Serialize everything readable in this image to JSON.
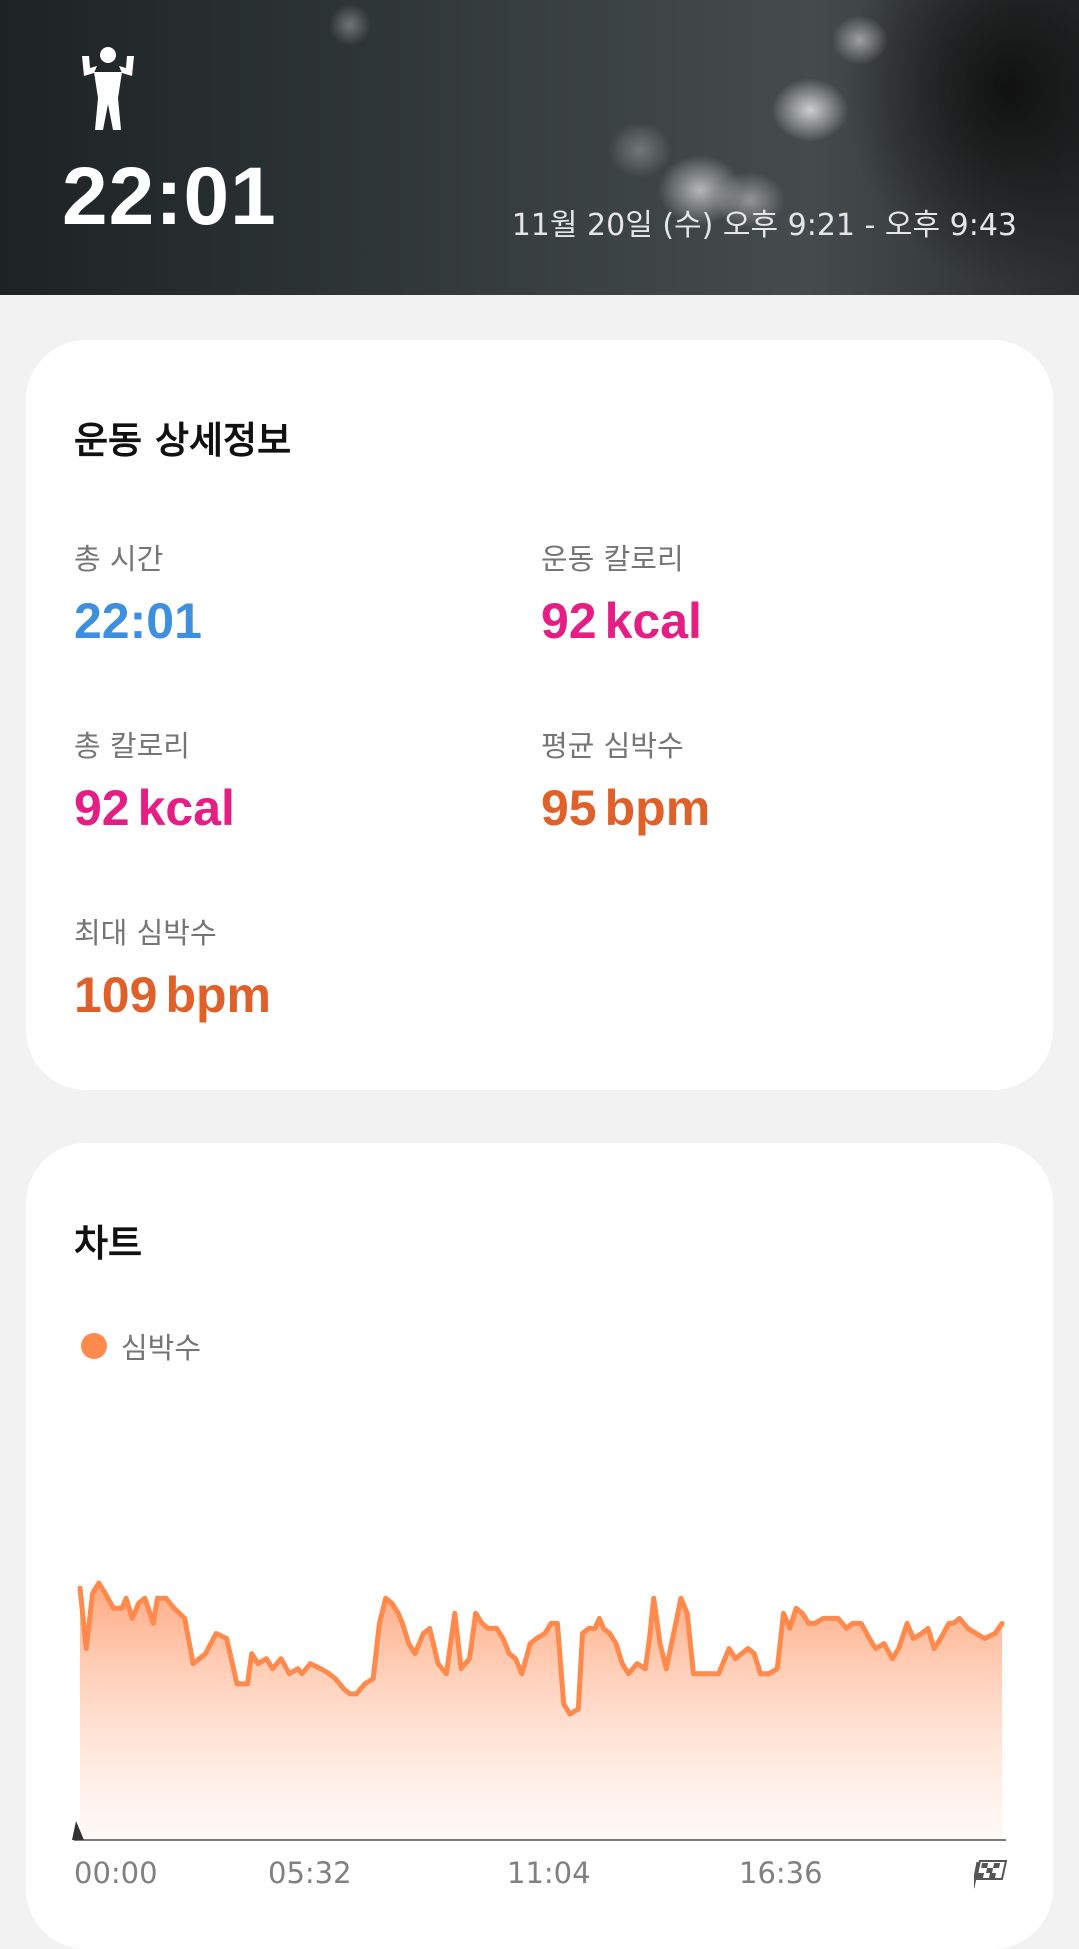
{
  "header": {
    "duration": "22:01",
    "date_range": "11월 20일 (수) 오후 9:21 - 오후 9:43",
    "workout_icon": "person-flexing-icon"
  },
  "details": {
    "title": "운동 상세정보",
    "stats": [
      {
        "label": "총 시간",
        "value": "22:01",
        "unit": "",
        "color": "#3d8fe0"
      },
      {
        "label": "운동 칼로리",
        "value": "92",
        "unit": "kcal",
        "color": "#e51e84"
      },
      {
        "label": "총 칼로리",
        "value": "92",
        "unit": "kcal",
        "color": "#e51e84"
      },
      {
        "label": "평균 심박수",
        "value": "95",
        "unit": "bpm",
        "color": "#e0602a"
      },
      {
        "label": "최대 심박수",
        "value": "109",
        "unit": "bpm",
        "color": "#e0602a"
      }
    ]
  },
  "chart_section": {
    "title": "차트",
    "legend_label": "심박수",
    "finish_icon": "checkered-flag-icon",
    "start_icon": "start-marker-icon"
  },
  "chart_data": {
    "type": "area",
    "series": [
      {
        "name": "심박수",
        "color": "#ff8a4c"
      }
    ],
    "x_tick_labels": [
      "00:00",
      "05:32",
      "11:04",
      "16:36"
    ],
    "x_unit": "mm:ss",
    "x_range": [
      "00:00",
      "22:01"
    ],
    "y_range_bpm": [
      58,
      112
    ],
    "grid": false,
    "legend_position": "top-left",
    "points": [
      [
        0.0,
        108
      ],
      [
        0.15,
        96
      ],
      [
        0.3,
        107
      ],
      [
        0.45,
        109
      ],
      [
        0.6,
        107
      ],
      [
        0.8,
        104
      ],
      [
        1.0,
        104
      ],
      [
        1.1,
        106
      ],
      [
        1.25,
        102
      ],
      [
        1.4,
        105
      ],
      [
        1.55,
        106
      ],
      [
        1.75,
        101
      ],
      [
        1.85,
        106
      ],
      [
        2.05,
        106
      ],
      [
        2.25,
        104
      ],
      [
        2.5,
        102
      ],
      [
        2.7,
        93
      ],
      [
        3.0,
        95
      ],
      [
        3.25,
        99
      ],
      [
        3.5,
        98
      ],
      [
        3.75,
        89
      ],
      [
        4.0,
        89
      ],
      [
        4.1,
        95
      ],
      [
        4.25,
        93
      ],
      [
        4.45,
        94
      ],
      [
        4.6,
        92
      ],
      [
        4.8,
        94
      ],
      [
        5.0,
        91
      ],
      [
        5.2,
        92
      ],
      [
        5.3,
        91
      ],
      [
        5.5,
        93
      ],
      [
        5.75,
        92
      ],
      [
        5.95,
        91
      ],
      [
        6.1,
        90
      ],
      [
        6.3,
        88
      ],
      [
        6.45,
        87
      ],
      [
        6.6,
        87
      ],
      [
        6.8,
        89
      ],
      [
        7.0,
        90
      ],
      [
        7.15,
        101
      ],
      [
        7.3,
        106
      ],
      [
        7.45,
        105
      ],
      [
        7.6,
        103
      ],
      [
        7.7,
        101
      ],
      [
        7.85,
        97
      ],
      [
        8.0,
        95
      ],
      [
        8.2,
        99
      ],
      [
        8.35,
        100
      ],
      [
        8.55,
        93
      ],
      [
        8.75,
        91
      ],
      [
        8.95,
        103
      ],
      [
        9.1,
        92
      ],
      [
        9.3,
        94
      ],
      [
        9.45,
        103
      ],
      [
        9.6,
        101
      ],
      [
        9.75,
        100
      ],
      [
        9.95,
        100
      ],
      [
        10.1,
        98
      ],
      [
        10.25,
        95
      ],
      [
        10.4,
        94
      ],
      [
        10.55,
        91
      ],
      [
        10.75,
        97
      ],
      [
        10.9,
        98
      ],
      [
        11.1,
        99
      ],
      [
        11.25,
        101
      ],
      [
        11.4,
        101
      ],
      [
        11.55,
        85
      ],
      [
        11.7,
        83
      ],
      [
        11.9,
        84
      ],
      [
        12.0,
        99
      ],
      [
        12.15,
        100
      ],
      [
        12.3,
        100
      ],
      [
        12.4,
        102
      ],
      [
        12.5,
        100
      ],
      [
        12.65,
        99
      ],
      [
        12.8,
        97
      ],
      [
        12.95,
        93
      ],
      [
        13.1,
        91
      ],
      [
        13.3,
        93
      ],
      [
        13.5,
        92
      ],
      [
        13.6,
        98
      ],
      [
        13.7,
        106
      ],
      [
        13.85,
        97
      ],
      [
        14.0,
        92
      ],
      [
        14.2,
        100
      ],
      [
        14.35,
        106
      ],
      [
        14.5,
        103
      ],
      [
        14.65,
        91
      ],
      [
        14.85,
        91
      ],
      [
        15.05,
        91
      ],
      [
        15.25,
        91
      ],
      [
        15.4,
        94
      ],
      [
        15.5,
        96
      ],
      [
        15.65,
        94
      ],
      [
        15.8,
        95
      ],
      [
        15.95,
        96
      ],
      [
        16.1,
        95
      ],
      [
        16.25,
        91
      ],
      [
        16.45,
        91
      ],
      [
        16.65,
        92
      ],
      [
        16.8,
        103
      ],
      [
        16.95,
        100
      ],
      [
        17.1,
        104
      ],
      [
        17.25,
        103
      ],
      [
        17.4,
        101
      ],
      [
        17.55,
        101
      ],
      [
        17.75,
        102
      ],
      [
        17.9,
        102
      ],
      [
        18.1,
        102
      ],
      [
        18.3,
        100
      ],
      [
        18.45,
        101
      ],
      [
        18.65,
        101
      ],
      [
        18.85,
        98
      ],
      [
        19.0,
        96
      ],
      [
        19.2,
        97
      ],
      [
        19.4,
        94
      ],
      [
        19.55,
        96
      ],
      [
        19.75,
        101
      ],
      [
        19.9,
        98
      ],
      [
        20.1,
        99
      ],
      [
        20.25,
        100
      ],
      [
        20.4,
        96
      ],
      [
        20.55,
        98
      ],
      [
        20.75,
        101
      ],
      [
        20.85,
        101
      ],
      [
        21.0,
        102
      ],
      [
        21.2,
        100
      ],
      [
        21.4,
        99
      ],
      [
        21.6,
        98
      ],
      [
        21.85,
        99
      ],
      [
        22.02,
        101
      ]
    ]
  }
}
